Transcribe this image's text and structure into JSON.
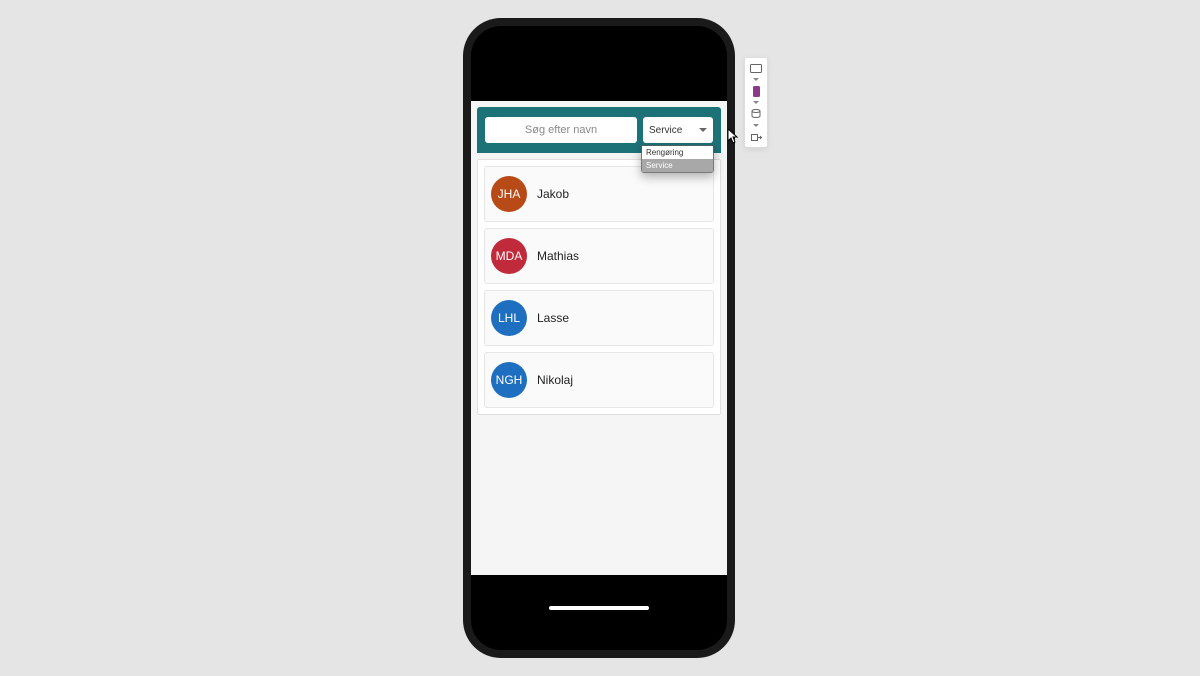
{
  "search": {
    "placeholder": "Søg efter navn"
  },
  "dropdown": {
    "selected": "Service",
    "options": [
      "Rengøring",
      "Service"
    ]
  },
  "people": [
    {
      "initials": "JHA",
      "name": "Jakob",
      "color": "#b84a17"
    },
    {
      "initials": "MDA",
      "name": "Mathias",
      "color": "#c12a3a"
    },
    {
      "initials": "LHL",
      "name": "Lasse",
      "color": "#1f6fc0"
    },
    {
      "initials": "NGH",
      "name": "Nikolaj",
      "color": "#1f6fc0"
    }
  ],
  "toolbar": {
    "icons": [
      "tablet-icon",
      "phone-icon",
      "database-icon",
      "export-icon"
    ]
  }
}
